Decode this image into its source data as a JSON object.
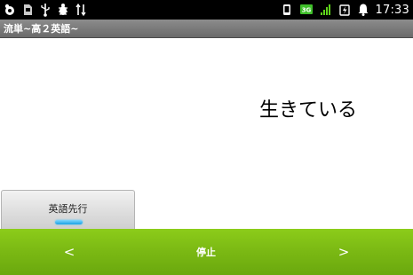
{
  "status_bar": {
    "time": "17:33",
    "network_badge": "3G",
    "left_icons": [
      "app-notification-icon",
      "sd-card-icon",
      "usb-icon",
      "debug-icon",
      "sync-icon"
    ],
    "right_icons": [
      "phone-vibrate-icon",
      "network-3g-icon",
      "signal-icon",
      "battery-charging-icon",
      "alarm-icon"
    ]
  },
  "title_bar": {
    "title": "流単~高２英語~"
  },
  "main": {
    "word": "生きている"
  },
  "mode_button": {
    "label": "英語先行"
  },
  "controls": {
    "prev": "<",
    "stop": "停止",
    "next": ">"
  },
  "colors": {
    "status_bar": "#000000",
    "title_bar": "#7a7a7a",
    "control_bar": "#7cba14",
    "indicator": "#1aa3e6"
  }
}
